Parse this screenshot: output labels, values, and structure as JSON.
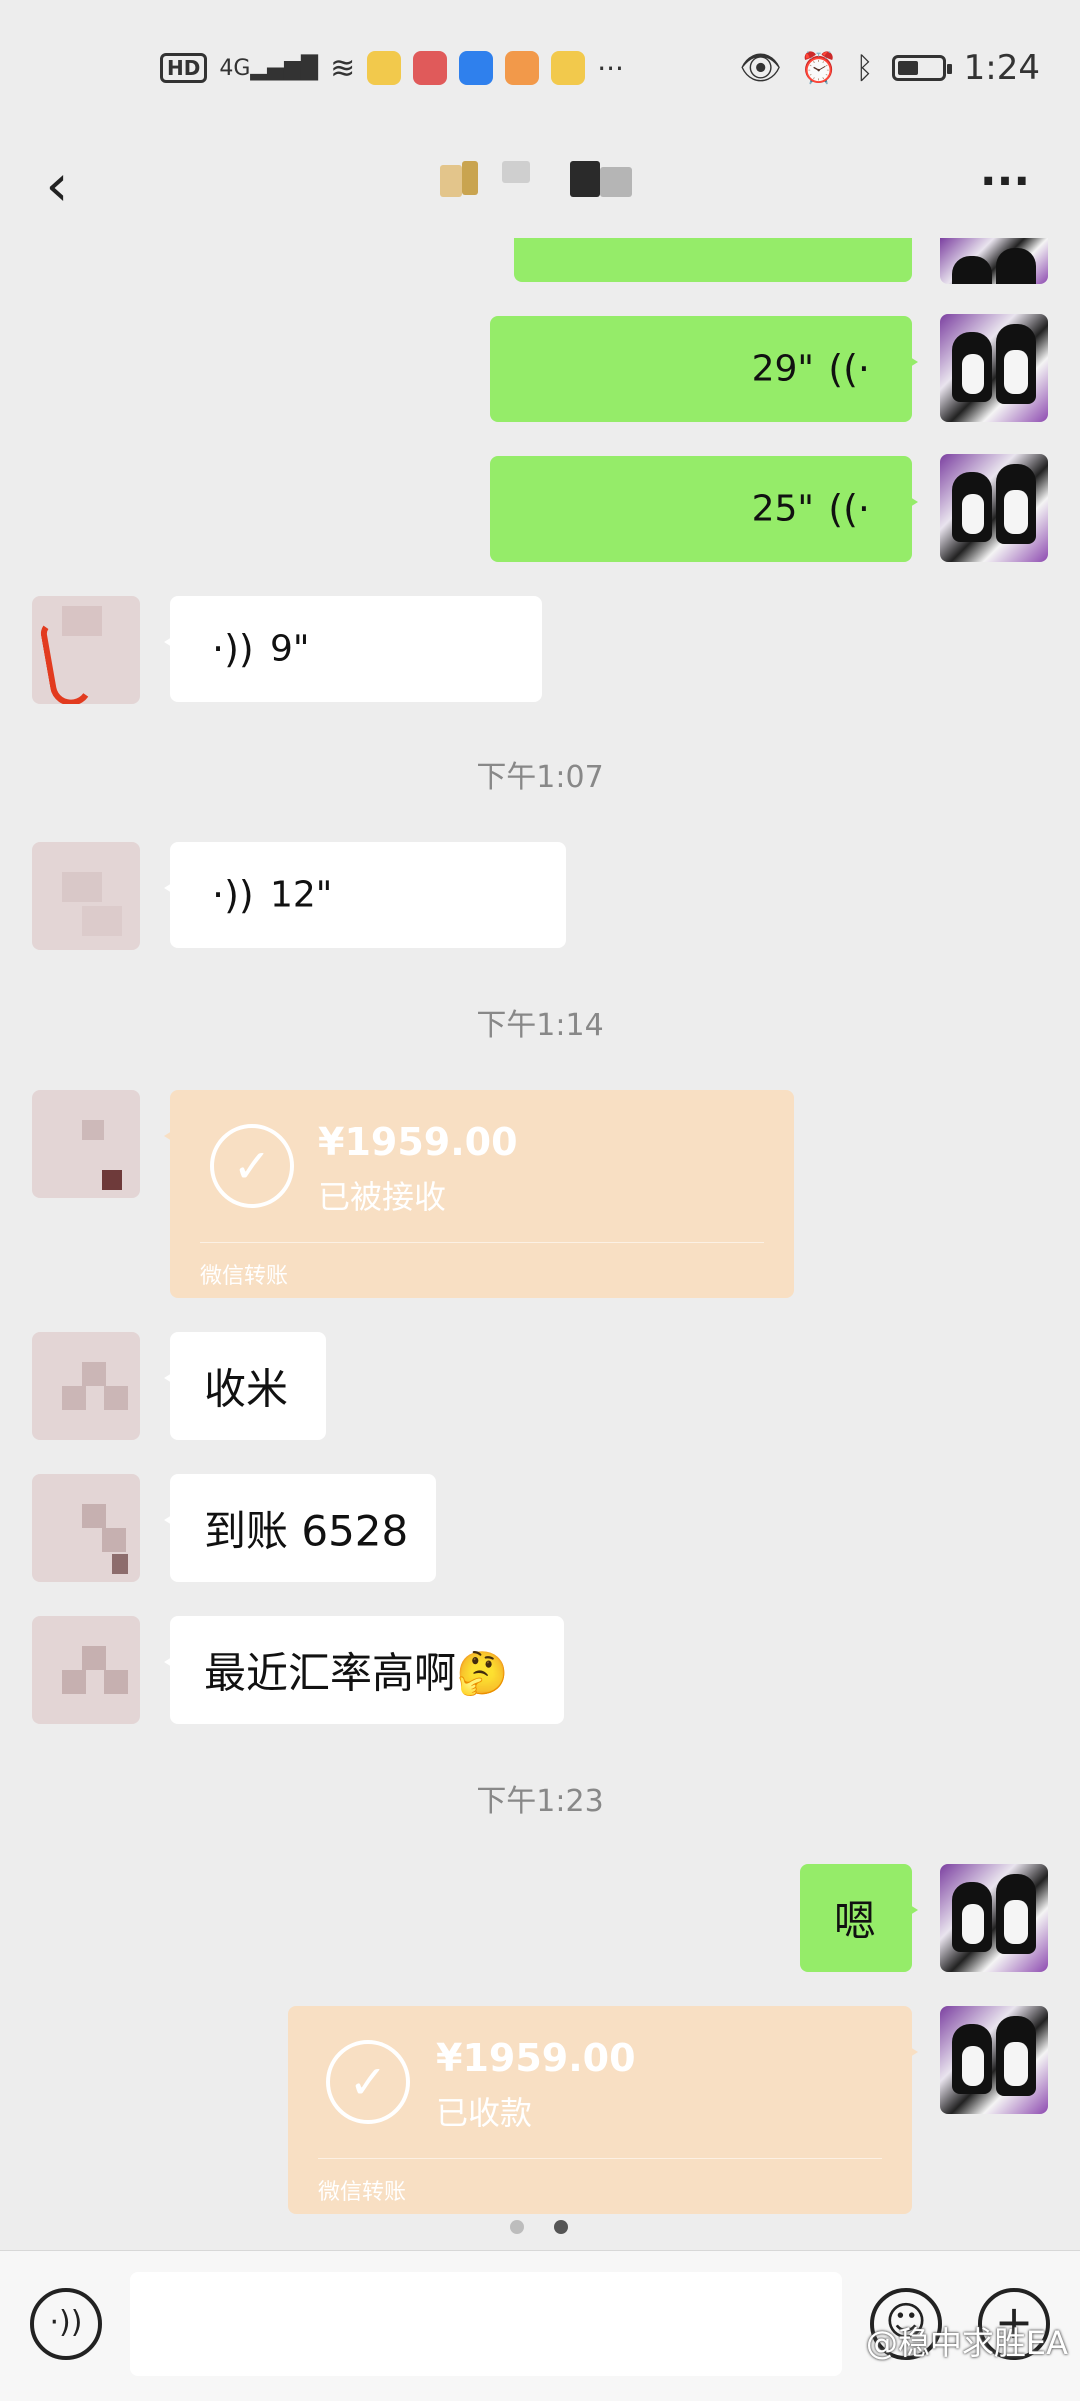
{
  "status_bar": {
    "network": "4G",
    "hd": "HD",
    "overflow": "···",
    "time": "1:24",
    "icons": [
      "hd-icon",
      "signal-icon",
      "wifi-icon",
      "app-icon-news",
      "app-icon-reader",
      "app-icon-blue",
      "app-icon-video",
      "app-icon-yellow",
      "eye-icon",
      "alarm-icon",
      "bluetooth-icon",
      "battery-icon"
    ]
  },
  "nav": {
    "back_glyph": "‹",
    "more_glyph": "···"
  },
  "messages": {
    "voice_29": "29\"",
    "voice_25": "25\"",
    "voice_9": "9\"",
    "time_1": "下午1:07",
    "voice_12": "12\"",
    "time_2": "下午1:14",
    "transfer_1_amount": "¥1959.00",
    "transfer_1_status": "已被接收",
    "transfer_1_footer": "微信转账",
    "text_1": "收米",
    "text_2": "到账 6528",
    "text_3": "最近汇率高啊🤔",
    "time_3": "下午1:23",
    "text_4": "嗯",
    "transfer_2_amount": "¥1959.00",
    "transfer_2_status": "已收款",
    "transfer_2_footer": "微信转账"
  },
  "page_indicator": {
    "pages": 2,
    "current": 2
  },
  "bottom_bar": {
    "voice_glyph": "🔊",
    "emoji_glyph": "☺",
    "plus_glyph": "+"
  },
  "watermark": "@稳中求胜EA",
  "colors": {
    "background": "#ededed",
    "sent_bubble": "#95ec69",
    "received_bubble": "#ffffff",
    "transfer_card": "#f8dfc3"
  }
}
